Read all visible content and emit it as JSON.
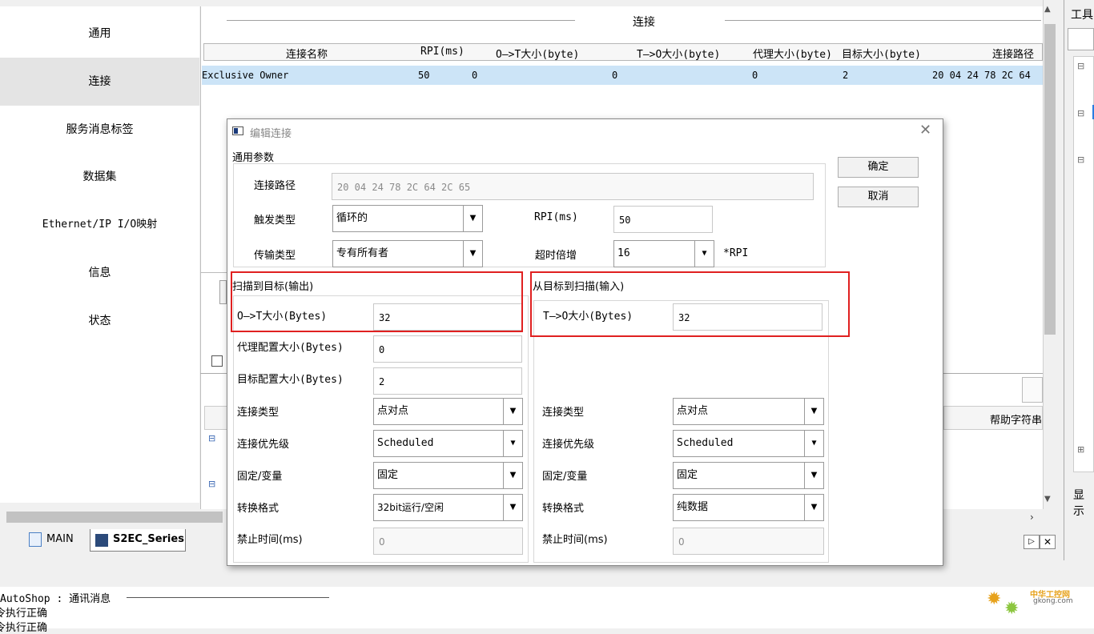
{
  "window": {
    "toolbox_title": "工具",
    "display_label": "显示"
  },
  "nav": {
    "items": [
      {
        "label": "通用"
      },
      {
        "label": "连接"
      },
      {
        "label": "服务消息标签"
      },
      {
        "label": "数据集"
      },
      {
        "label": "Ethernet/IP I/O映射"
      },
      {
        "label": "信息"
      },
      {
        "label": "状态"
      }
    ],
    "active_index": 1
  },
  "connections": {
    "section_title": "连接",
    "columns": [
      "连接名称",
      "RPI(ms)",
      "O—>T大小(byte)",
      "T—>O大小(byte)",
      "代理大小(byte)",
      "目标大小(byte)",
      "连接路径"
    ],
    "rows": [
      [
        "Exclusive Owner",
        "50",
        "0",
        "0",
        "0",
        "2",
        "20 04 24 78 2C 64"
      ]
    ],
    "help_column": "帮助字符串"
  },
  "tabs": [
    {
      "label": "MAIN"
    },
    {
      "label": "S2EC_Series"
    }
  ],
  "output": {
    "header": "AutoShop : 通讯消息",
    "lines": [
      "令执行正确",
      "令执行正确"
    ]
  },
  "watermark": {
    "site_name": "中华工控网",
    "domain": "gkong.com"
  },
  "dialog": {
    "title": "编辑连接",
    "general_params": "通用参数",
    "ok": "确定",
    "cancel": "取消",
    "conn_path_label": "连接路径",
    "conn_path_value": "20 04 24 78 2C 64 2C 65",
    "trigger_label": "触发类型",
    "trigger_value": "循环的",
    "rpi_label": "RPI(ms)",
    "rpi_value": "50",
    "transport_label": "传输类型",
    "transport_value": "专有所有者",
    "timeout_label": "超时倍增",
    "timeout_value": "16",
    "timeout_unit": "*RPI",
    "output_group": "扫描到目标(输出)",
    "input_group": "从目标到扫描(输入)",
    "ot_size_label": "O—>T大小(Bytes)",
    "ot_size_value": "32",
    "to_size_label": "T—>O大小(Bytes)",
    "to_size_value": "32",
    "proxy_cfg_label": "代理配置大小(Bytes)",
    "proxy_cfg_value": "0",
    "target_cfg_label": "目标配置大小(Bytes)",
    "target_cfg_value": "2",
    "out": {
      "conn_type_label": "连接类型",
      "conn_type_value": "点对点",
      "priority_label": "连接优先级",
      "priority_value": "Scheduled",
      "fixvar_label": "固定/变量",
      "fixvar_value": "固定",
      "format_label": "转换格式",
      "format_value": "32bit运行/空闲",
      "inhibit_label": "禁止时间(ms)",
      "inhibit_value": "0"
    },
    "in": {
      "conn_type_label": "连接类型",
      "conn_type_value": "点对点",
      "priority_label": "连接优先级",
      "priority_value": "Scheduled",
      "fixvar_label": "固定/变量",
      "fixvar_value": "固定",
      "format_label": "转换格式",
      "format_value": "纯数据",
      "inhibit_label": "禁止时间(ms)",
      "inhibit_value": "0"
    }
  },
  "colors": {
    "highlight": "#e02020",
    "selected_row": "#cce4f7"
  }
}
